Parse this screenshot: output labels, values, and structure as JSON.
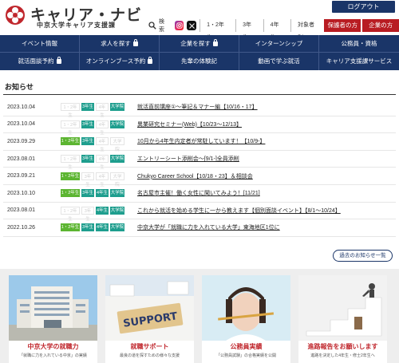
{
  "header": {
    "logo_title": "キャリア・ナビ",
    "logo_subtitle": "中京大学キャリア支援課",
    "login_label": "ログアウト",
    "search_label": "検索",
    "grades": [
      "1・2年生",
      "3年生",
      "4年生"
    ],
    "target_label": "対象者別",
    "guardians_label": "保護者の方",
    "companies_label": "企業の方"
  },
  "nav": {
    "row1": [
      {
        "label": "イベント情報",
        "locked": false
      },
      {
        "label": "求人を探す",
        "locked": true
      },
      {
        "label": "企業を探す",
        "locked": true
      },
      {
        "label": "インターンシップ",
        "locked": false
      },
      {
        "label": "公務員・資格",
        "locked": false
      }
    ],
    "row2": [
      {
        "label": "就活面談予約",
        "locked": true
      },
      {
        "label": "オンラインブース予約",
        "locked": true
      },
      {
        "label": "先輩の体験記",
        "locked": false
      },
      {
        "label": "動画で学ぶ就活",
        "locked": false
      },
      {
        "label": "キャリア支援課サービス",
        "locked": false
      }
    ]
  },
  "news": {
    "heading": "お知らせ",
    "tag_labels": [
      "1・2年生",
      "3年生",
      "4年生",
      "大学院"
    ],
    "items": [
      {
        "date": "2023.10.04",
        "tags": [
          false,
          true,
          false,
          true
        ],
        "title": "就活直前講座①～筆記＆マナー編【10/16・17】"
      },
      {
        "date": "2023.10.04",
        "tags": [
          false,
          true,
          false,
          true
        ],
        "title": "異業研究セミナー(Web)【10/23～12/13】"
      },
      {
        "date": "2023.09.29",
        "tags": [
          true,
          true,
          false,
          false
        ],
        "title": "10月から4年生内定者が常駐しています！【10/9-】"
      },
      {
        "date": "2023.08.01",
        "tags": [
          false,
          true,
          false,
          true
        ],
        "title": "エントリーシート添削会～[9/1-]全員添削"
      },
      {
        "date": "2023.09.21",
        "tags": [
          true,
          false,
          false,
          false
        ],
        "title": "Chukyo Career School【10/18・23】＆相談会"
      },
      {
        "date": "2023.10.10",
        "tags": [
          true,
          true,
          true,
          true
        ],
        "title": "名古屋市主催！働く女性に聞いてみよう！[11/21]"
      },
      {
        "date": "2023.08.01",
        "tags": [
          false,
          false,
          true,
          true
        ],
        "title": "これから就活を始める学生に一から教えます【個別面談イベント】【8/1～10/24】"
      },
      {
        "date": "2022.10.26",
        "tags": [
          true,
          true,
          true,
          true
        ],
        "title": "中京大学が「就職に力を入れている大学」東海地区1位に"
      }
    ],
    "more_label": "過去のお知らせ一覧"
  },
  "banners": [
    {
      "title": "中京大学の就職力",
      "desc": "「就職に力を入れている中京」の実績"
    },
    {
      "title": "就職サポート",
      "desc": "最良の道を探すための様々な支援"
    },
    {
      "title": "公務員実績",
      "desc": "「公務員試験」の合格実績を公開"
    },
    {
      "title": "進路報告をお願いします",
      "desc": "進路を決定した4年生・修士2年生へ"
    }
  ],
  "banner_image_text": {
    "support": "SUPPORT"
  },
  "colors": {
    "navy": "#1a3568",
    "red": "#b81c22",
    "tag_green": "#5cb531",
    "tag_teal": "#1e9e8e"
  }
}
